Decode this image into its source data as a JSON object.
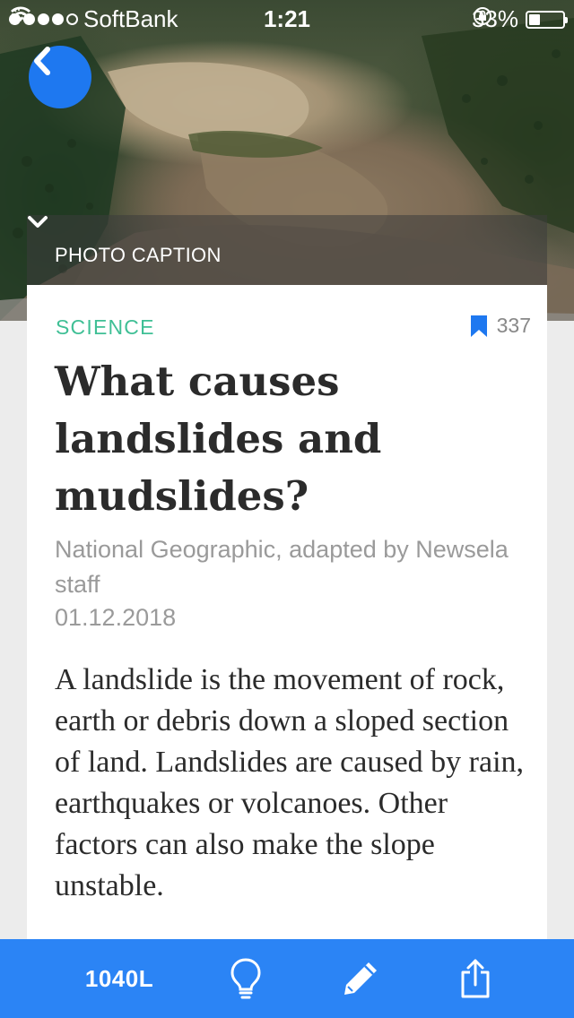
{
  "status_bar": {
    "carrier": "SoftBank",
    "time": "1:21",
    "battery_percent_label": "33%",
    "battery_level": 0.33,
    "signal_bars": 4,
    "signal_bars_total": 5
  },
  "hero": {
    "caption_label": "PHOTO CAPTION",
    "back_icon": "chevron-left-icon",
    "caption_toggle_icon": "chevron-down-icon"
  },
  "article": {
    "category": "SCIENCE",
    "bookmark_count": "337",
    "title": "What causes landslides and mudslides?",
    "byline": "National Geographic, adapted by Newsela staff",
    "date": "01.12.2018",
    "body": "A landslide is the movement of rock, earth or debris down a sloped section of land. Landslides are caused by rain, earthquakes or volcanoes. Other factors can also make the slope unstable."
  },
  "toolbar": {
    "reading_level": "1040L",
    "icons": [
      "lightbulb-icon",
      "pencil-icon",
      "share-icon"
    ]
  },
  "colors": {
    "accent_blue": "#1e78f0",
    "toolbar_blue": "#2b84f5",
    "category_green": "#3fbf95",
    "bookmark_blue": "#1e78f0",
    "muted_text": "#9a9a9a",
    "body_text": "#2b2b2b"
  }
}
